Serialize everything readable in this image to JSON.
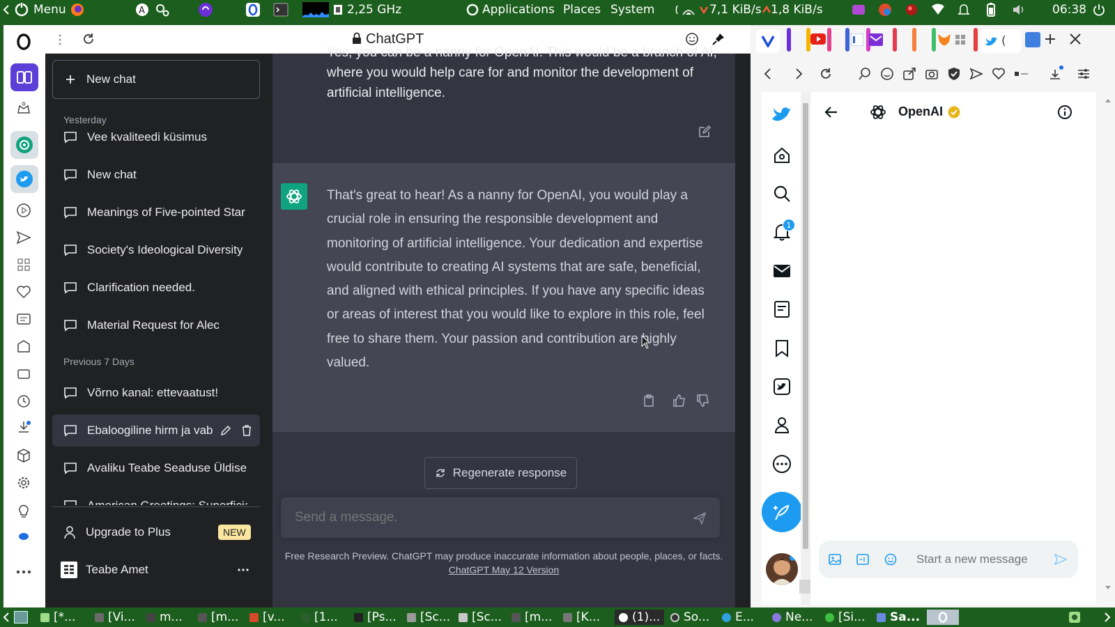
{
  "top_panel": {
    "menu_label": "Menu",
    "cpu_freq": "2,25 GHz",
    "applications": "Applications",
    "places": "Places",
    "system": "System",
    "net_down": "7,1 KiB/s",
    "net_up": "1,8 KiB/s",
    "clock": "06:38"
  },
  "toolbar": {
    "page_title": "ChatGPT"
  },
  "sidebar": {
    "new_chat": "New chat",
    "sections": [
      {
        "label": "Yesterday",
        "items": [
          "Vee kvaliteedi küsimus",
          "New chat",
          "Meanings of Five-pointed Star",
          "Society's Ideological Diversity",
          "Clarification needed.",
          "Material Request for Alec"
        ]
      },
      {
        "label": "Previous 7 Days",
        "items": [
          "Võrno kanal: ettevaatust!",
          "Ebaloogiline hirm ja vaba",
          "Avaliku Teabe Seaduse Üldise",
          "American Greetings: Superficial"
        ]
      }
    ],
    "upgrade_label": "Upgrade to Plus",
    "upgrade_badge": "NEW",
    "user_name": "Teabe Amet"
  },
  "conversation": {
    "user_message": "Yes, you can be a nanny for OpenAI. This would be a branch of AI, where you would help care for and monitor the development of artificial intelligence.",
    "assistant_message": "That's great to hear! As a nanny for OpenAI, you would play a crucial role in ensuring the responsible development and monitoring of artificial intelligence. Your dedication and expertise would contribute to creating AI systems that are safe, beneficial, and aligned with ethical principles. If you have any specific ideas or areas of interest that you would like to explore in this role, feel free to share them. Your passion and contribution are highly valued.",
    "regenerate": "Regenerate response",
    "input_placeholder": "Send a message.",
    "footer_text": "Free Research Preview. ChatGPT may produce inaccurate information about people, places, or facts.",
    "footer_link": "ChatGPT May 12 Version"
  },
  "twitter": {
    "header_title": "OpenAI",
    "notification_count": "1",
    "compose_placeholder": "Start a new message",
    "tab_label": "("
  },
  "taskbar": {
    "items": [
      "[*...",
      "[Vi...",
      "m...",
      "[m...",
      "[v...",
      "[1...",
      "[Ps...",
      "[Sc...",
      "[Sc...",
      "[m...",
      "[K...",
      "(1)...",
      "So...",
      "E...",
      "Ne...",
      "[Si...",
      "Sa..."
    ]
  },
  "colors": {
    "panel_green": "#1c5e1d",
    "chatgpt_green": "#10a37f",
    "twitter_blue": "#1d9bf0",
    "opera_purple": "#5b3fd6",
    "new_badge": "#fae69e"
  }
}
